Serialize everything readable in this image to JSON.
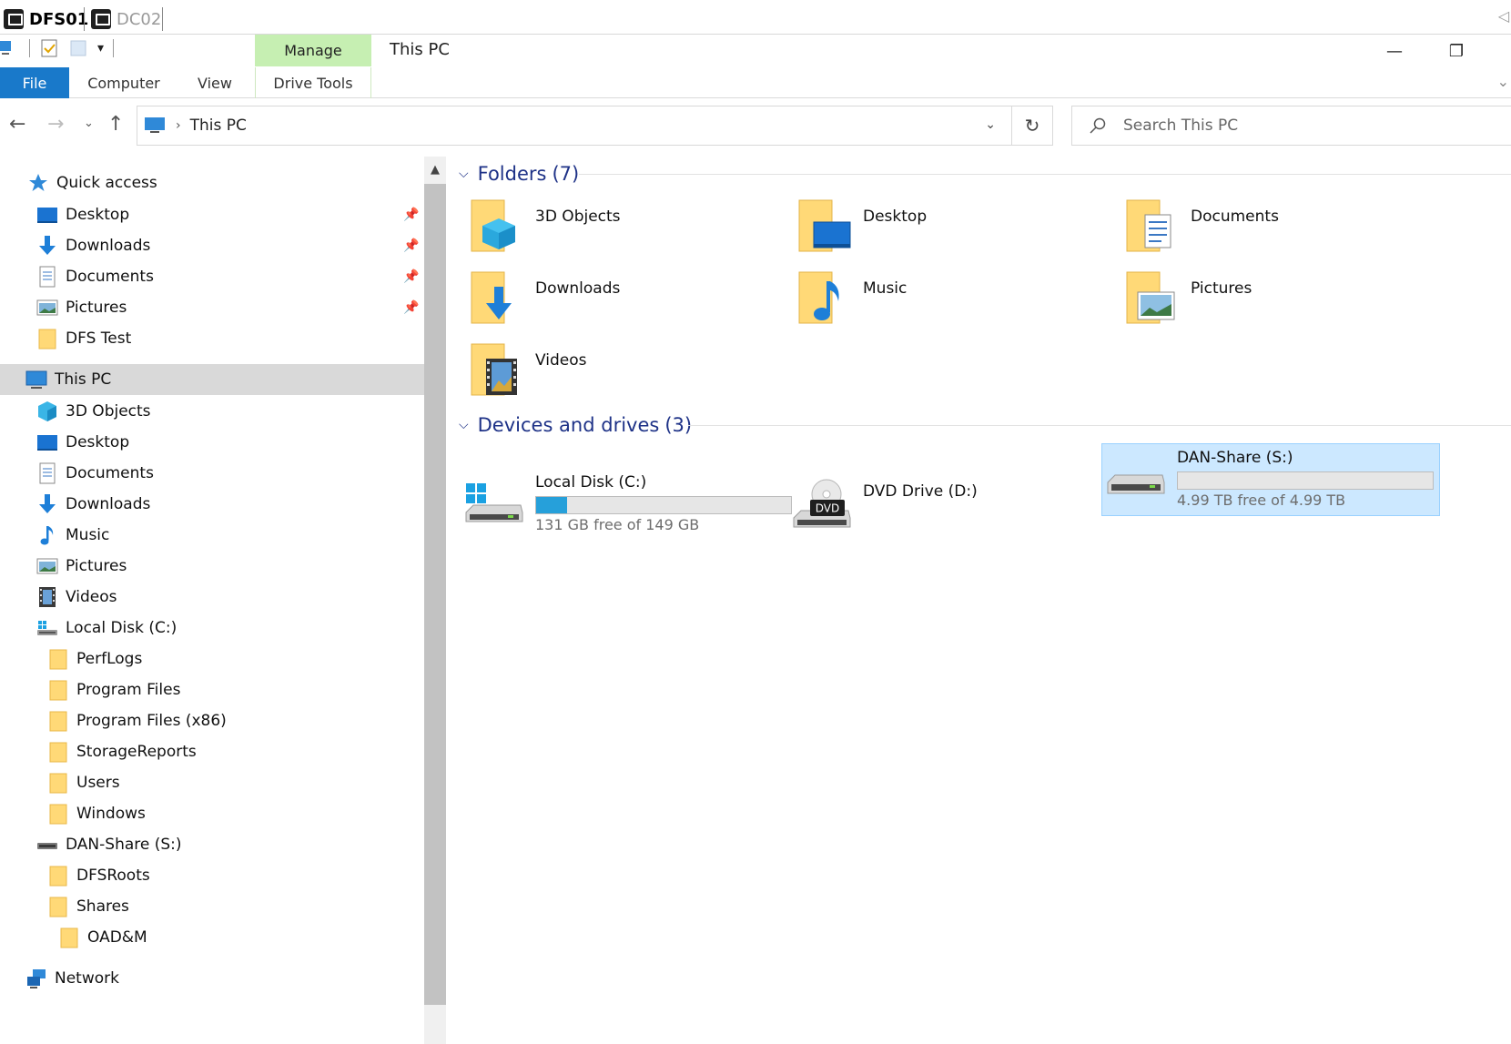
{
  "session": {
    "tabs": [
      {
        "label": "DFS01",
        "active": true
      },
      {
        "label": "DC02",
        "active": false
      }
    ]
  },
  "window": {
    "title": "This PC",
    "manage_tab": "Manage",
    "minimize_glyph": "—",
    "restore_glyph": "❐"
  },
  "ribbon": {
    "file": "File",
    "computer": "Computer",
    "view": "View",
    "drive_tools": "Drive Tools"
  },
  "address": {
    "location": "This PC",
    "search_placeholder": "Search This PC"
  },
  "navpane": {
    "quick_access": "Quick access",
    "quick_items": [
      {
        "label": "Desktop",
        "icon": "desktop-icon",
        "pinned": true
      },
      {
        "label": "Downloads",
        "icon": "downloads-icon",
        "pinned": true
      },
      {
        "label": "Documents",
        "icon": "documents-icon",
        "pinned": true
      },
      {
        "label": "Pictures",
        "icon": "pictures-icon",
        "pinned": true
      },
      {
        "label": "DFS Test",
        "icon": "folder-icon",
        "pinned": false
      }
    ],
    "this_pc": "This PC",
    "pc_items": [
      {
        "label": "3D Objects",
        "icon": "3d-objects-icon"
      },
      {
        "label": "Desktop",
        "icon": "desktop-icon"
      },
      {
        "label": "Documents",
        "icon": "documents-icon"
      },
      {
        "label": "Downloads",
        "icon": "downloads-icon"
      },
      {
        "label": "Music",
        "icon": "music-icon"
      },
      {
        "label": "Pictures",
        "icon": "pictures-icon"
      },
      {
        "label": "Videos",
        "icon": "videos-icon"
      },
      {
        "label": "Local Disk (C:)",
        "icon": "local-disk-icon"
      }
    ],
    "c_folders": [
      "PerfLogs",
      "Program Files",
      "Program Files (x86)",
      "StorageReports",
      "Users",
      "Windows"
    ],
    "s_drive": "DAN-Share (S:)",
    "s_folders": [
      "DFSRoots",
      "Shares"
    ],
    "shares_child": "OAD&M",
    "network": "Network"
  },
  "content": {
    "folders_group": {
      "title": "Folders",
      "count": "(7)"
    },
    "folders": [
      {
        "label": "3D Objects",
        "icon": "3d-objects-folder-icon"
      },
      {
        "label": "Desktop",
        "icon": "desktop-folder-icon"
      },
      {
        "label": "Documents",
        "icon": "documents-folder-icon"
      },
      {
        "label": "Downloads",
        "icon": "downloads-folder-icon"
      },
      {
        "label": "Music",
        "icon": "music-folder-icon"
      },
      {
        "label": "Pictures",
        "icon": "pictures-folder-icon"
      },
      {
        "label": "Videos",
        "icon": "videos-folder-icon"
      }
    ],
    "devices_group": {
      "title": "Devices and drives",
      "count": "(3)"
    },
    "drives": [
      {
        "label": "Local Disk (C:)",
        "free": "131 GB free of 149 GB",
        "used_fraction": 0.12,
        "selected": false
      },
      {
        "label": "DVD Drive (D:)",
        "free": "",
        "used_fraction": null,
        "selected": false
      },
      {
        "label": "DAN-Share (S:)",
        "free": "4.99 TB free of 4.99 TB",
        "used_fraction": 0.0,
        "selected": true
      }
    ],
    "dvd_badge": "DVD"
  },
  "colors": {
    "accent": "#1979ca",
    "manage_tab": "#c6efb2",
    "selection": "#cce8ff",
    "progress": "#26a0da",
    "group_title": "#1e3287"
  }
}
